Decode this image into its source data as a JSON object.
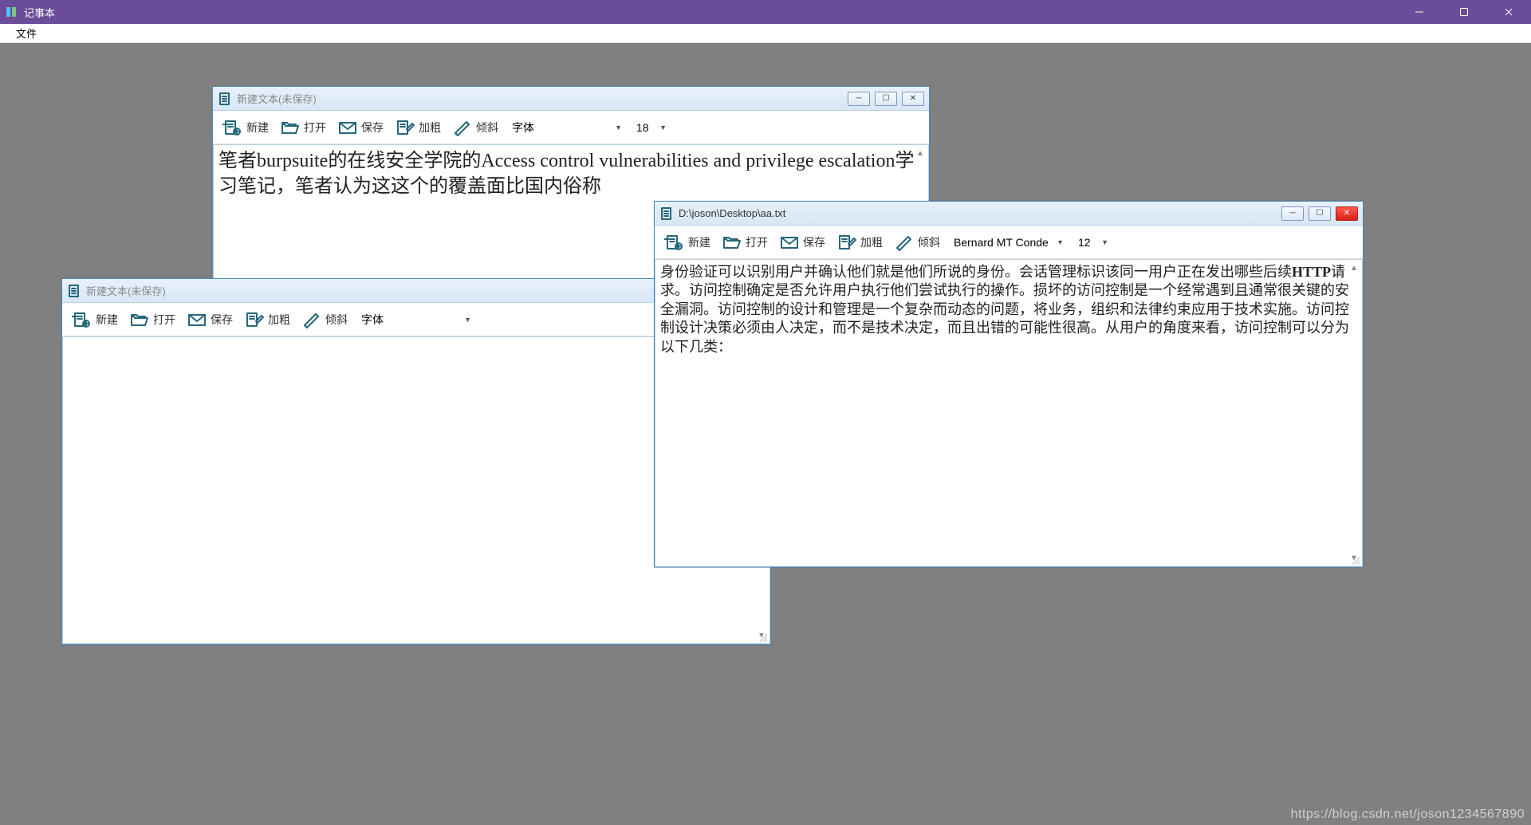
{
  "app": {
    "title": "记事本",
    "menu": {
      "file": "文件"
    }
  },
  "toolbar": {
    "new": "新建",
    "open": "打开",
    "save": "保存",
    "bold": "加粗",
    "italic": "倾斜",
    "font_label": "字体"
  },
  "windows": {
    "w1": {
      "title": "新建文本(未保存)",
      "font_name": "字体",
      "font_size": "18",
      "content": "笔者burpsuite的在线安全学院的Access control vulnerabilities and privilege escalation学习笔记，笔者认为这这个的覆盖面比国内俗称"
    },
    "w2": {
      "title": "新建文本(未保存)",
      "font_name": "字体",
      "content": ""
    },
    "w3": {
      "title": "D:\\joson\\Desktop\\aa.txt",
      "font_name": "Bernard MT Conde",
      "font_size": "12",
      "content_pre": "身份验证可以识别用户并确认他们就是他们所说的身份。会话管理标识该同一用户正在发出哪些后续",
      "content_bold": "HTTP",
      "content_post": "请求。访问控制确定是否允许用户执行他们尝试执行的操作。损坏的访问控制是一个经常遇到且通常很关键的安全漏洞。访问控制的设计和管理是一个复杂而动态的问题，将业务，组织和法律约束应用于技术实施。访问控制设计决策必须由人决定，而不是技术决定，而且出错的可能性很高。从用户的角度来看，访问控制可以分为以下几类："
    }
  },
  "watermark": "https://blog.csdn.net/joson1234567890"
}
